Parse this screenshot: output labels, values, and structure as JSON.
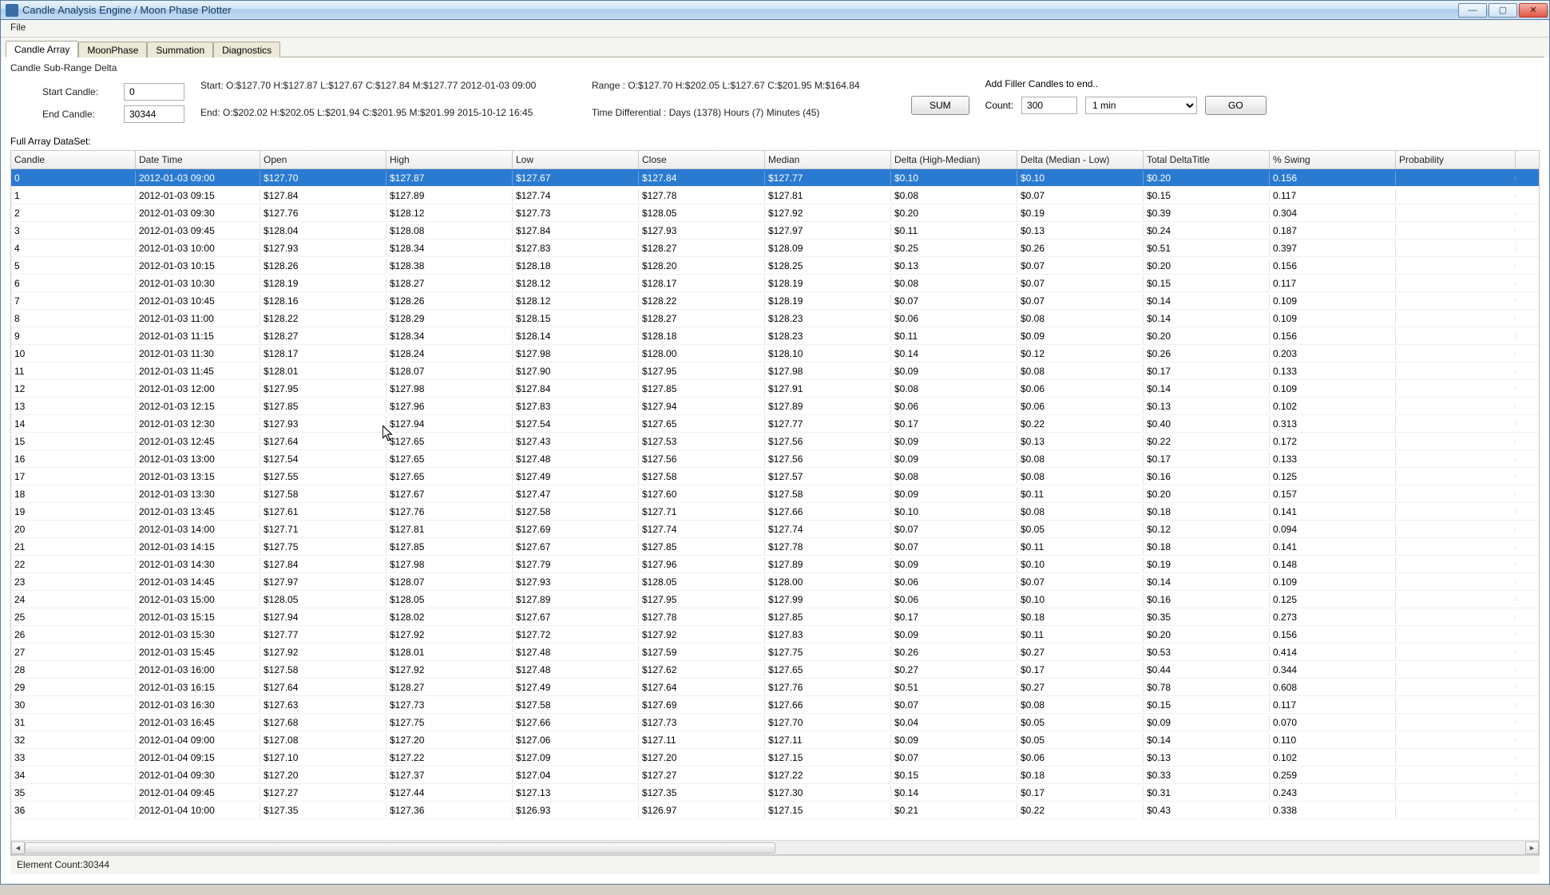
{
  "window": {
    "title": "Candle Analysis Engine / Moon Phase Plotter"
  },
  "menu": {
    "file": "File"
  },
  "tabs": {
    "candleArray": "Candle Array",
    "moonPhase": "MoonPhase",
    "summation": "Summation",
    "diagnostics": "Diagnostics"
  },
  "group": {
    "title": "Candle Sub-Range Delta",
    "startLabel": "Start Candle:",
    "startVal": "0",
    "endLabel": "End Candle:",
    "endVal": "30344",
    "startLine": "Start: O:$127.70 H:$127.87 L:$127.67 C:$127.84 M:$127.77 2012-01-03 09:00",
    "endLine": "End: O:$202.02 H:$202.05 L:$201.94 C:$201.95 M:$201.99 2015-10-12 16:45",
    "rangeLine": "Range : O:$127.70 H:$202.05 L:$127.67 C:$201.95 M:$164.84",
    "timeDiff": "Time Differential : Days (1378) Hours (7) Minutes (45)",
    "sumBtn": "SUM",
    "fillerLabel": "Add Filler Candles to end..",
    "countLabel": "Count:",
    "countVal": "300",
    "intervalVal": "1 min",
    "goBtn": "GO"
  },
  "datasetLabel": "Full Array DataSet:",
  "columns": {
    "candle": "Candle",
    "dt": "Date Time",
    "open": "Open",
    "high": "High",
    "low": "Low",
    "close": "Close",
    "median": "Median",
    "dhm": "Delta (High-Median)",
    "dml": "Delta (Median - Low)",
    "tdt": "Total DeltaTitle",
    "sw": "% Swing",
    "pr": "Probability"
  },
  "rows": [
    {
      "i": "0",
      "dt": "2012-01-03 09:00",
      "o": "$127.70",
      "h": "$127.87",
      "l": "$127.67",
      "c": "$127.84",
      "m": "$127.77",
      "dhm": "$0.10",
      "dml": "$0.10",
      "tdt": "$0.20",
      "sw": "0.156",
      "pr": ""
    },
    {
      "i": "1",
      "dt": "2012-01-03 09:15",
      "o": "$127.84",
      "h": "$127.89",
      "l": "$127.74",
      "c": "$127.78",
      "m": "$127.81",
      "dhm": "$0.08",
      "dml": "$0.07",
      "tdt": "$0.15",
      "sw": "0.117",
      "pr": ""
    },
    {
      "i": "2",
      "dt": "2012-01-03 09:30",
      "o": "$127.76",
      "h": "$128.12",
      "l": "$127.73",
      "c": "$128.05",
      "m": "$127.92",
      "dhm": "$0.20",
      "dml": "$0.19",
      "tdt": "$0.39",
      "sw": "0.304",
      "pr": ""
    },
    {
      "i": "3",
      "dt": "2012-01-03 09:45",
      "o": "$128.04",
      "h": "$128.08",
      "l": "$127.84",
      "c": "$127.93",
      "m": "$127.97",
      "dhm": "$0.11",
      "dml": "$0.13",
      "tdt": "$0.24",
      "sw": "0.187",
      "pr": ""
    },
    {
      "i": "4",
      "dt": "2012-01-03 10:00",
      "o": "$127.93",
      "h": "$128.34",
      "l": "$127.83",
      "c": "$128.27",
      "m": "$128.09",
      "dhm": "$0.25",
      "dml": "$0.26",
      "tdt": "$0.51",
      "sw": "0.397",
      "pr": ""
    },
    {
      "i": "5",
      "dt": "2012-01-03 10:15",
      "o": "$128.26",
      "h": "$128.38",
      "l": "$128.18",
      "c": "$128.20",
      "m": "$128.25",
      "dhm": "$0.13",
      "dml": "$0.07",
      "tdt": "$0.20",
      "sw": "0.156",
      "pr": ""
    },
    {
      "i": "6",
      "dt": "2012-01-03 10:30",
      "o": "$128.19",
      "h": "$128.27",
      "l": "$128.12",
      "c": "$128.17",
      "m": "$128.19",
      "dhm": "$0.08",
      "dml": "$0.07",
      "tdt": "$0.15",
      "sw": "0.117",
      "pr": ""
    },
    {
      "i": "7",
      "dt": "2012-01-03 10:45",
      "o": "$128.16",
      "h": "$128.26",
      "l": "$128.12",
      "c": "$128.22",
      "m": "$128.19",
      "dhm": "$0.07",
      "dml": "$0.07",
      "tdt": "$0.14",
      "sw": "0.109",
      "pr": ""
    },
    {
      "i": "8",
      "dt": "2012-01-03 11:00",
      "o": "$128.22",
      "h": "$128.29",
      "l": "$128.15",
      "c": "$128.27",
      "m": "$128.23",
      "dhm": "$0.06",
      "dml": "$0.08",
      "tdt": "$0.14",
      "sw": "0.109",
      "pr": ""
    },
    {
      "i": "9",
      "dt": "2012-01-03 11:15",
      "o": "$128.27",
      "h": "$128.34",
      "l": "$128.14",
      "c": "$128.18",
      "m": "$128.23",
      "dhm": "$0.11",
      "dml": "$0.09",
      "tdt": "$0.20",
      "sw": "0.156",
      "pr": ""
    },
    {
      "i": "10",
      "dt": "2012-01-03 11:30",
      "o": "$128.17",
      "h": "$128.24",
      "l": "$127.98",
      "c": "$128.00",
      "m": "$128.10",
      "dhm": "$0.14",
      "dml": "$0.12",
      "tdt": "$0.26",
      "sw": "0.203",
      "pr": ""
    },
    {
      "i": "11",
      "dt": "2012-01-03 11:45",
      "o": "$128.01",
      "h": "$128.07",
      "l": "$127.90",
      "c": "$127.95",
      "m": "$127.98",
      "dhm": "$0.09",
      "dml": "$0.08",
      "tdt": "$0.17",
      "sw": "0.133",
      "pr": ""
    },
    {
      "i": "12",
      "dt": "2012-01-03 12:00",
      "o": "$127.95",
      "h": "$127.98",
      "l": "$127.84",
      "c": "$127.85",
      "m": "$127.91",
      "dhm": "$0.08",
      "dml": "$0.06",
      "tdt": "$0.14",
      "sw": "0.109",
      "pr": ""
    },
    {
      "i": "13",
      "dt": "2012-01-03 12:15",
      "o": "$127.85",
      "h": "$127.96",
      "l": "$127.83",
      "c": "$127.94",
      "m": "$127.89",
      "dhm": "$0.06",
      "dml": "$0.06",
      "tdt": "$0.13",
      "sw": "0.102",
      "pr": ""
    },
    {
      "i": "14",
      "dt": "2012-01-03 12:30",
      "o": "$127.93",
      "h": "$127.94",
      "l": "$127.54",
      "c": "$127.65",
      "m": "$127.77",
      "dhm": "$0.17",
      "dml": "$0.22",
      "tdt": "$0.40",
      "sw": "0.313",
      "pr": ""
    },
    {
      "i": "15",
      "dt": "2012-01-03 12:45",
      "o": "$127.64",
      "h": "$127.65",
      "l": "$127.43",
      "c": "$127.53",
      "m": "$127.56",
      "dhm": "$0.09",
      "dml": "$0.13",
      "tdt": "$0.22",
      "sw": "0.172",
      "pr": ""
    },
    {
      "i": "16",
      "dt": "2012-01-03 13:00",
      "o": "$127.54",
      "h": "$127.65",
      "l": "$127.48",
      "c": "$127.56",
      "m": "$127.56",
      "dhm": "$0.09",
      "dml": "$0.08",
      "tdt": "$0.17",
      "sw": "0.133",
      "pr": ""
    },
    {
      "i": "17",
      "dt": "2012-01-03 13:15",
      "o": "$127.55",
      "h": "$127.65",
      "l": "$127.49",
      "c": "$127.58",
      "m": "$127.57",
      "dhm": "$0.08",
      "dml": "$0.08",
      "tdt": "$0.16",
      "sw": "0.125",
      "pr": ""
    },
    {
      "i": "18",
      "dt": "2012-01-03 13:30",
      "o": "$127.58",
      "h": "$127.67",
      "l": "$127.47",
      "c": "$127.60",
      "m": "$127.58",
      "dhm": "$0.09",
      "dml": "$0.11",
      "tdt": "$0.20",
      "sw": "0.157",
      "pr": ""
    },
    {
      "i": "19",
      "dt": "2012-01-03 13:45",
      "o": "$127.61",
      "h": "$127.76",
      "l": "$127.58",
      "c": "$127.71",
      "m": "$127.66",
      "dhm": "$0.10",
      "dml": "$0.08",
      "tdt": "$0.18",
      "sw": "0.141",
      "pr": ""
    },
    {
      "i": "20",
      "dt": "2012-01-03 14:00",
      "o": "$127.71",
      "h": "$127.81",
      "l": "$127.69",
      "c": "$127.74",
      "m": "$127.74",
      "dhm": "$0.07",
      "dml": "$0.05",
      "tdt": "$0.12",
      "sw": "0.094",
      "pr": ""
    },
    {
      "i": "21",
      "dt": "2012-01-03 14:15",
      "o": "$127.75",
      "h": "$127.85",
      "l": "$127.67",
      "c": "$127.85",
      "m": "$127.78",
      "dhm": "$0.07",
      "dml": "$0.11",
      "tdt": "$0.18",
      "sw": "0.141",
      "pr": ""
    },
    {
      "i": "22",
      "dt": "2012-01-03 14:30",
      "o": "$127.84",
      "h": "$127.98",
      "l": "$127.79",
      "c": "$127.96",
      "m": "$127.89",
      "dhm": "$0.09",
      "dml": "$0.10",
      "tdt": "$0.19",
      "sw": "0.148",
      "pr": ""
    },
    {
      "i": "23",
      "dt": "2012-01-03 14:45",
      "o": "$127.97",
      "h": "$128.07",
      "l": "$127.93",
      "c": "$128.05",
      "m": "$128.00",
      "dhm": "$0.06",
      "dml": "$0.07",
      "tdt": "$0.14",
      "sw": "0.109",
      "pr": ""
    },
    {
      "i": "24",
      "dt": "2012-01-03 15:00",
      "o": "$128.05",
      "h": "$128.05",
      "l": "$127.89",
      "c": "$127.95",
      "m": "$127.99",
      "dhm": "$0.06",
      "dml": "$0.10",
      "tdt": "$0.16",
      "sw": "0.125",
      "pr": ""
    },
    {
      "i": "25",
      "dt": "2012-01-03 15:15",
      "o": "$127.94",
      "h": "$128.02",
      "l": "$127.67",
      "c": "$127.78",
      "m": "$127.85",
      "dhm": "$0.17",
      "dml": "$0.18",
      "tdt": "$0.35",
      "sw": "0.273",
      "pr": ""
    },
    {
      "i": "26",
      "dt": "2012-01-03 15:30",
      "o": "$127.77",
      "h": "$127.92",
      "l": "$127.72",
      "c": "$127.92",
      "m": "$127.83",
      "dhm": "$0.09",
      "dml": "$0.11",
      "tdt": "$0.20",
      "sw": "0.156",
      "pr": ""
    },
    {
      "i": "27",
      "dt": "2012-01-03 15:45",
      "o": "$127.92",
      "h": "$128.01",
      "l": "$127.48",
      "c": "$127.59",
      "m": "$127.75",
      "dhm": "$0.26",
      "dml": "$0.27",
      "tdt": "$0.53",
      "sw": "0.414",
      "pr": ""
    },
    {
      "i": "28",
      "dt": "2012-01-03 16:00",
      "o": "$127.58",
      "h": "$127.92",
      "l": "$127.48",
      "c": "$127.62",
      "m": "$127.65",
      "dhm": "$0.27",
      "dml": "$0.17",
      "tdt": "$0.44",
      "sw": "0.344",
      "pr": ""
    },
    {
      "i": "29",
      "dt": "2012-01-03 16:15",
      "o": "$127.64",
      "h": "$128.27",
      "l": "$127.49",
      "c": "$127.64",
      "m": "$127.76",
      "dhm": "$0.51",
      "dml": "$0.27",
      "tdt": "$0.78",
      "sw": "0.608",
      "pr": ""
    },
    {
      "i": "30",
      "dt": "2012-01-03 16:30",
      "o": "$127.63",
      "h": "$127.73",
      "l": "$127.58",
      "c": "$127.69",
      "m": "$127.66",
      "dhm": "$0.07",
      "dml": "$0.08",
      "tdt": "$0.15",
      "sw": "0.117",
      "pr": ""
    },
    {
      "i": "31",
      "dt": "2012-01-03 16:45",
      "o": "$127.68",
      "h": "$127.75",
      "l": "$127.66",
      "c": "$127.73",
      "m": "$127.70",
      "dhm": "$0.04",
      "dml": "$0.05",
      "tdt": "$0.09",
      "sw": "0.070",
      "pr": ""
    },
    {
      "i": "32",
      "dt": "2012-01-04 09:00",
      "o": "$127.08",
      "h": "$127.20",
      "l": "$127.06",
      "c": "$127.11",
      "m": "$127.11",
      "dhm": "$0.09",
      "dml": "$0.05",
      "tdt": "$0.14",
      "sw": "0.110",
      "pr": ""
    },
    {
      "i": "33",
      "dt": "2012-01-04 09:15",
      "o": "$127.10",
      "h": "$127.22",
      "l": "$127.09",
      "c": "$127.20",
      "m": "$127.15",
      "dhm": "$0.07",
      "dml": "$0.06",
      "tdt": "$0.13",
      "sw": "0.102",
      "pr": ""
    },
    {
      "i": "34",
      "dt": "2012-01-04 09:30",
      "o": "$127.20",
      "h": "$127.37",
      "l": "$127.04",
      "c": "$127.27",
      "m": "$127.22",
      "dhm": "$0.15",
      "dml": "$0.18",
      "tdt": "$0.33",
      "sw": "0.259",
      "pr": ""
    },
    {
      "i": "35",
      "dt": "2012-01-04 09:45",
      "o": "$127.27",
      "h": "$127.44",
      "l": "$127.13",
      "c": "$127.35",
      "m": "$127.30",
      "dhm": "$0.14",
      "dml": "$0.17",
      "tdt": "$0.31",
      "sw": "0.243",
      "pr": ""
    },
    {
      "i": "36",
      "dt": "2012-01-04 10:00",
      "o": "$127.35",
      "h": "$127.36",
      "l": "$126.93",
      "c": "$126.97",
      "m": "$127.15",
      "dhm": "$0.21",
      "dml": "$0.22",
      "tdt": "$0.43",
      "sw": "0.338",
      "pr": ""
    }
  ],
  "status": "Element Count:30344"
}
